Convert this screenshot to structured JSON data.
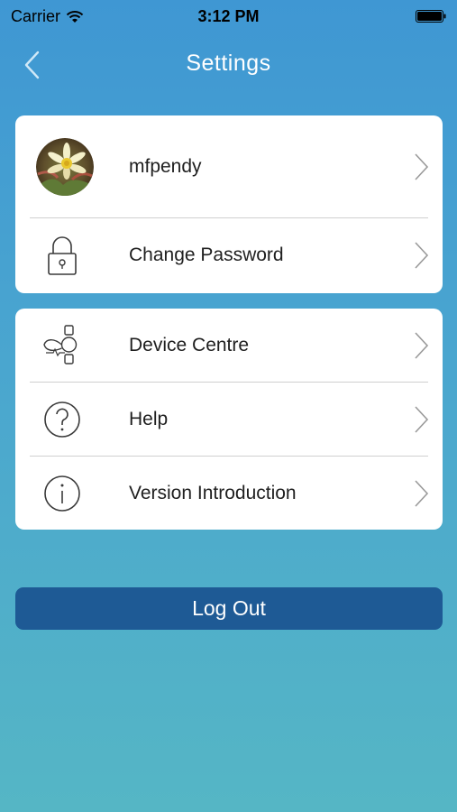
{
  "status_bar": {
    "carrier": "Carrier",
    "time": "3:12 PM"
  },
  "nav": {
    "back_icon": "back-chevron-icon",
    "title": "Settings"
  },
  "account_section": {
    "items": [
      {
        "label": "mfpendy",
        "icon": "avatar-flower"
      },
      {
        "label": "Change Password",
        "icon": "lock-icon"
      }
    ]
  },
  "app_section": {
    "items": [
      {
        "label": "Device Centre",
        "icon": "device-icon"
      },
      {
        "label": "Help",
        "icon": "help-icon"
      },
      {
        "label": "Version Introduction",
        "icon": "info-icon"
      }
    ]
  },
  "logout": {
    "label": "Log Out"
  },
  "colors": {
    "background_top": "#3f97d3",
    "background_bottom": "#55b6c5",
    "card": "#ffffff",
    "logout_button": "#1e5a95",
    "icon_stroke": "#3a3a3a"
  }
}
